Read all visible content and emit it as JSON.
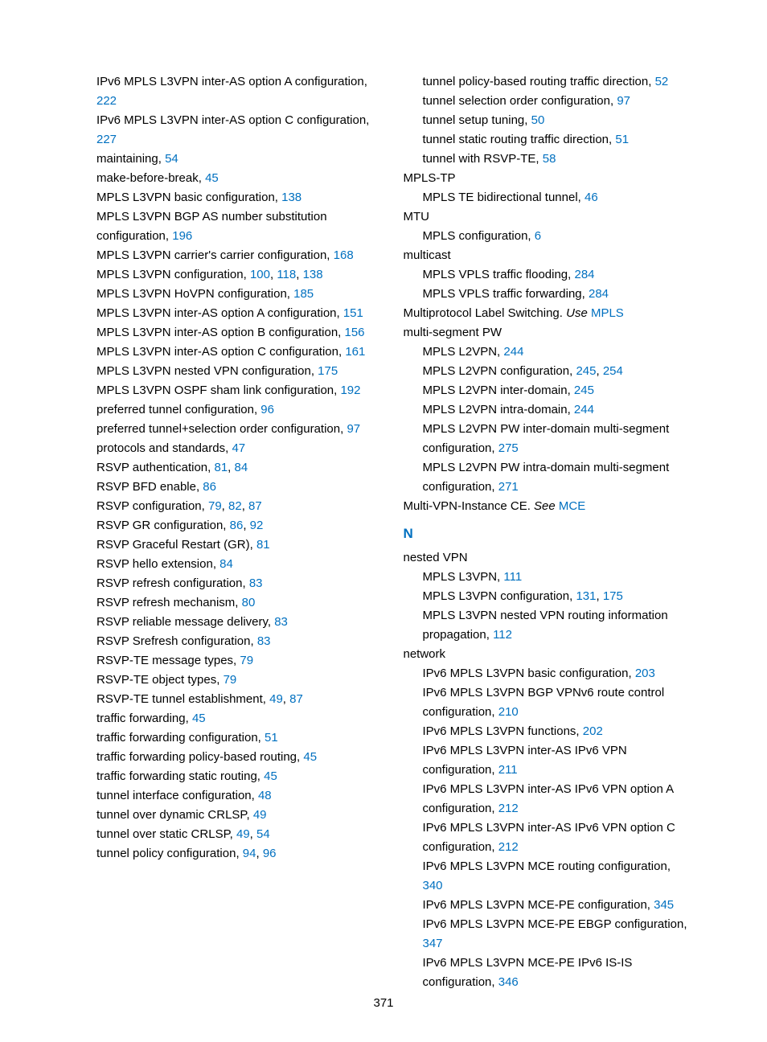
{
  "page_number": "371",
  "section_N": "N",
  "left": [
    {
      "t": "IPv6 MPLS L3VPN inter-AS option A configuration, ",
      "l": [
        "222"
      ],
      "indent": 0
    },
    {
      "t": "IPv6 MPLS L3VPN inter-AS option C configuration, ",
      "l": [
        "227"
      ],
      "indent": 0
    },
    {
      "t": "maintaining, ",
      "l": [
        "54"
      ],
      "indent": 0
    },
    {
      "t": "make-before-break, ",
      "l": [
        "45"
      ],
      "indent": 0
    },
    {
      "t": "MPLS L3VPN basic configuration, ",
      "l": [
        "138"
      ],
      "indent": 0
    },
    {
      "t": "MPLS L3VPN BGP AS number substitution configuration, ",
      "l": [
        "196"
      ],
      "indent": 0
    },
    {
      "t": "MPLS L3VPN carrier's carrier configuration, ",
      "l": [
        "168"
      ],
      "indent": 0
    },
    {
      "t": "MPLS L3VPN configuration, ",
      "l": [
        "100",
        "118",
        "138"
      ],
      "indent": 0
    },
    {
      "t": "MPLS L3VPN HoVPN configuration, ",
      "l": [
        "185"
      ],
      "indent": 0
    },
    {
      "t": "MPLS L3VPN inter-AS option A configuration, ",
      "l": [
        "151"
      ],
      "indent": 0
    },
    {
      "t": "MPLS L3VPN inter-AS option B configuration, ",
      "l": [
        "156"
      ],
      "indent": 0
    },
    {
      "t": "MPLS L3VPN inter-AS option C configuration, ",
      "l": [
        "161"
      ],
      "indent": 0
    },
    {
      "t": "MPLS L3VPN nested VPN configuration, ",
      "l": [
        "175"
      ],
      "indent": 0
    },
    {
      "t": "MPLS L3VPN OSPF sham link configuration, ",
      "l": [
        "192"
      ],
      "indent": 0
    },
    {
      "t": "preferred tunnel configuration, ",
      "l": [
        "96"
      ],
      "indent": 0
    },
    {
      "t": "preferred tunnel+selection order configuration, ",
      "l": [
        "97"
      ],
      "indent": 0
    },
    {
      "t": "protocols and standards, ",
      "l": [
        "47"
      ],
      "indent": 0
    },
    {
      "t": "RSVP authentication, ",
      "l": [
        "81",
        "84"
      ],
      "indent": 0
    },
    {
      "t": "RSVP BFD enable, ",
      "l": [
        "86"
      ],
      "indent": 0
    },
    {
      "t": "RSVP configuration, ",
      "l": [
        "79",
        "82",
        "87"
      ],
      "indent": 0
    },
    {
      "t": "RSVP GR configuration, ",
      "l": [
        "86",
        "92"
      ],
      "indent": 0
    },
    {
      "t": "RSVP Graceful Restart (GR), ",
      "l": [
        "81"
      ],
      "indent": 0
    },
    {
      "t": "RSVP hello extension, ",
      "l": [
        "84"
      ],
      "indent": 0
    },
    {
      "t": "RSVP refresh configuration, ",
      "l": [
        "83"
      ],
      "indent": 0
    },
    {
      "t": "RSVP refresh mechanism, ",
      "l": [
        "80"
      ],
      "indent": 0
    },
    {
      "t": "RSVP reliable message delivery, ",
      "l": [
        "83"
      ],
      "indent": 0
    },
    {
      "t": "RSVP Srefresh configuration, ",
      "l": [
        "83"
      ],
      "indent": 0
    },
    {
      "t": "RSVP-TE message types, ",
      "l": [
        "79"
      ],
      "indent": 0
    },
    {
      "t": "RSVP-TE object types, ",
      "l": [
        "79"
      ],
      "indent": 0
    },
    {
      "t": "RSVP-TE tunnel establishment, ",
      "l": [
        "49",
        "87"
      ],
      "indent": 0
    },
    {
      "t": "traffic forwarding, ",
      "l": [
        "45"
      ],
      "indent": 0
    },
    {
      "t": "traffic forwarding configuration, ",
      "l": [
        "51"
      ],
      "indent": 0
    },
    {
      "t": "traffic forwarding policy-based routing, ",
      "l": [
        "45"
      ],
      "indent": 0
    },
    {
      "t": "traffic forwarding static routing, ",
      "l": [
        "45"
      ],
      "indent": 0
    },
    {
      "t": "tunnel interface configuration, ",
      "l": [
        "48"
      ],
      "indent": 0
    },
    {
      "t": "tunnel over dynamic CRLSP, ",
      "l": [
        "49"
      ],
      "indent": 0
    },
    {
      "t": "tunnel over static CRLSP, ",
      "l": [
        "49",
        "54"
      ],
      "indent": 0
    },
    {
      "t": "tunnel policy configuration, ",
      "l": [
        "94",
        "96"
      ],
      "indent": 0
    }
  ],
  "right_top": [
    {
      "t": "tunnel policy-based routing traffic direction, ",
      "l": [
        "52"
      ],
      "indent": 1
    },
    {
      "t": "tunnel selection order configuration, ",
      "l": [
        "97"
      ],
      "indent": 1
    },
    {
      "t": "tunnel setup tuning, ",
      "l": [
        "50"
      ],
      "indent": 1
    },
    {
      "t": "tunnel static routing traffic direction, ",
      "l": [
        "51"
      ],
      "indent": 1
    },
    {
      "t": "tunnel with RSVP-TE, ",
      "l": [
        "58"
      ],
      "indent": 1
    },
    {
      "t": "MPLS-TP",
      "l": [],
      "indent": 0,
      "head": true
    },
    {
      "t": "MPLS TE bidirectional tunnel, ",
      "l": [
        "46"
      ],
      "indent": 1
    },
    {
      "t": "MTU",
      "l": [],
      "indent": 0,
      "head": true
    },
    {
      "t": "MPLS configuration, ",
      "l": [
        "6"
      ],
      "indent": 1
    },
    {
      "t": "multicast",
      "l": [],
      "indent": 0,
      "head": true
    },
    {
      "t": "MPLS VPLS traffic flooding, ",
      "l": [
        "284"
      ],
      "indent": 1
    },
    {
      "t": "MPLS VPLS traffic forwarding, ",
      "l": [
        "284"
      ],
      "indent": 1
    },
    {
      "pre": "Multiprotocol Label Switching. ",
      "ital": "Use ",
      "linktext": "MPLS",
      "indent": 0,
      "xref": true
    },
    {
      "t": "multi-segment PW",
      "l": [],
      "indent": 0,
      "head": true
    },
    {
      "t": "MPLS L2VPN, ",
      "l": [
        "244"
      ],
      "indent": 1
    },
    {
      "t": "MPLS L2VPN configuration, ",
      "l": [
        "245",
        "254"
      ],
      "indent": 1
    },
    {
      "t": "MPLS L2VPN inter-domain, ",
      "l": [
        "245"
      ],
      "indent": 1
    },
    {
      "t": "MPLS L2VPN intra-domain, ",
      "l": [
        "244"
      ],
      "indent": 1
    },
    {
      "t": "MPLS L2VPN PW inter-domain multi-segment configuration, ",
      "l": [
        "275"
      ],
      "indent": 1
    },
    {
      "t": "MPLS L2VPN PW intra-domain multi-segment configuration, ",
      "l": [
        "271"
      ],
      "indent": 1
    },
    {
      "pre": "Multi-VPN-Instance CE. ",
      "ital": "See ",
      "linktext": "MCE",
      "indent": 0,
      "xref": true
    }
  ],
  "right_bottom": [
    {
      "t": "nested VPN",
      "l": [],
      "indent": 0,
      "head": true
    },
    {
      "t": "MPLS L3VPN, ",
      "l": [
        "111"
      ],
      "indent": 1
    },
    {
      "t": "MPLS L3VPN configuration, ",
      "l": [
        "131",
        "175"
      ],
      "indent": 1
    },
    {
      "t": "MPLS L3VPN nested VPN routing information propagation, ",
      "l": [
        "112"
      ],
      "indent": 1
    },
    {
      "t": "network",
      "l": [],
      "indent": 0,
      "head": true
    },
    {
      "t": "IPv6 MPLS L3VPN basic configuration, ",
      "l": [
        "203"
      ],
      "indent": 1
    },
    {
      "t": "IPv6 MPLS L3VPN BGP VPNv6 route control configuration, ",
      "l": [
        "210"
      ],
      "indent": 1
    },
    {
      "t": "IPv6 MPLS L3VPN functions, ",
      "l": [
        "202"
      ],
      "indent": 1
    },
    {
      "t": "IPv6 MPLS L3VPN inter-AS IPv6 VPN configuration, ",
      "l": [
        "211"
      ],
      "indent": 1
    },
    {
      "t": "IPv6 MPLS L3VPN inter-AS IPv6 VPN option A configuration, ",
      "l": [
        "212"
      ],
      "indent": 1
    },
    {
      "t": "IPv6 MPLS L3VPN inter-AS IPv6 VPN option C configuration, ",
      "l": [
        "212"
      ],
      "indent": 1
    },
    {
      "t": "IPv6 MPLS L3VPN MCE routing configuration, ",
      "l": [
        "340"
      ],
      "indent": 1
    },
    {
      "t": "IPv6 MPLS L3VPN MCE-PE configuration, ",
      "l": [
        "345"
      ],
      "indent": 1
    },
    {
      "t": "IPv6 MPLS L3VPN MCE-PE EBGP configuration, ",
      "l": [
        "347"
      ],
      "indent": 1
    },
    {
      "t": "IPv6 MPLS L3VPN MCE-PE IPv6 IS-IS configuration, ",
      "l": [
        "346"
      ],
      "indent": 1
    }
  ]
}
